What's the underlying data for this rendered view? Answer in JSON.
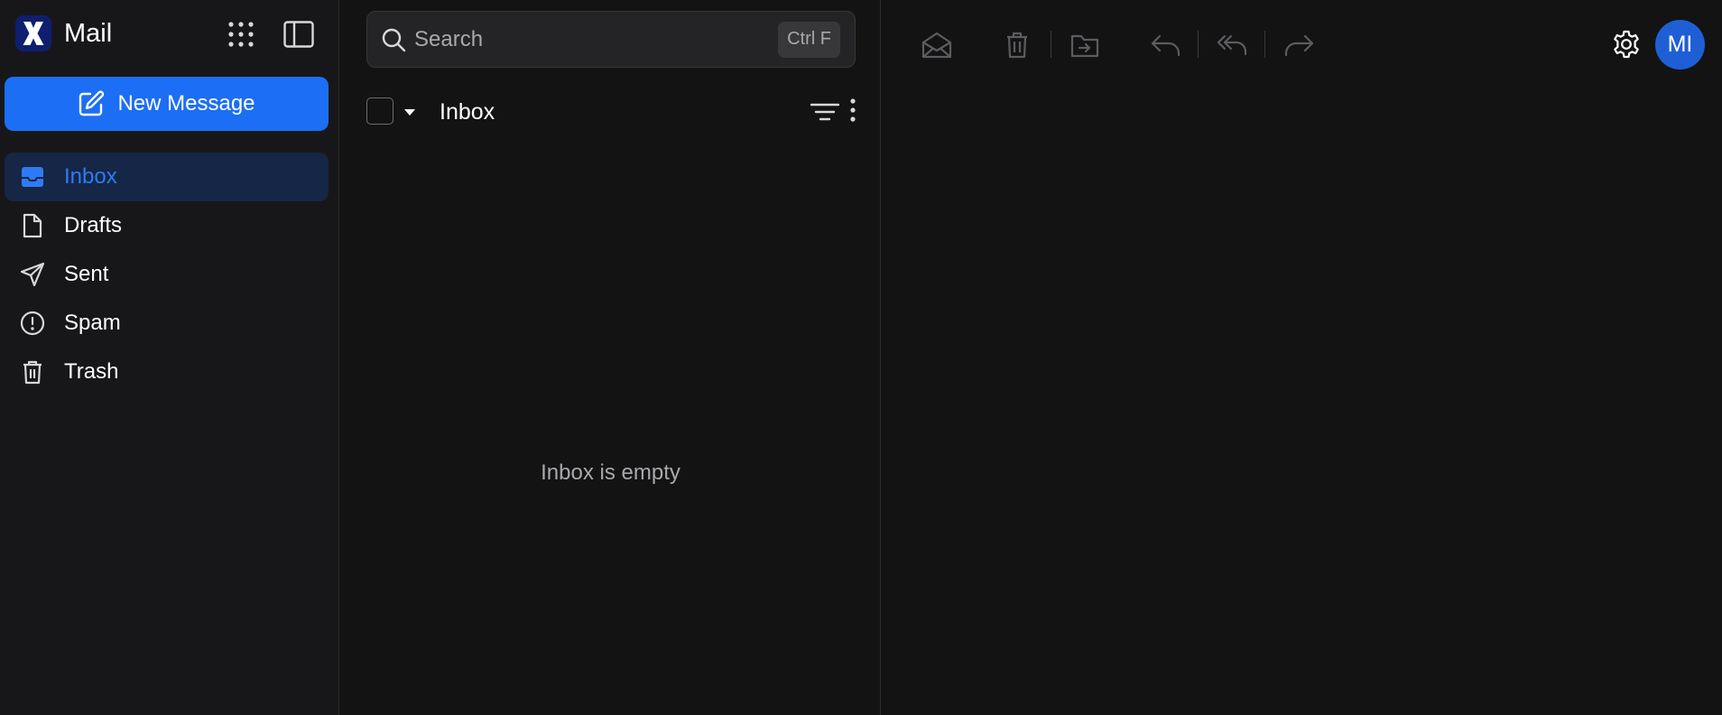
{
  "app": {
    "logo_letter": "X",
    "name": "Mail",
    "apps_icon": "apps-grid-icon",
    "sidebar_toggle_icon": "sidebar-toggle-icon"
  },
  "compose": {
    "label": "New Message",
    "icon": "compose-icon"
  },
  "sidebar": {
    "items": [
      {
        "label": "Inbox",
        "icon": "inbox-icon",
        "active": true
      },
      {
        "label": "Drafts",
        "icon": "file-icon"
      },
      {
        "label": "Sent",
        "icon": "send-icon"
      },
      {
        "label": "Spam",
        "icon": "alert-circle-icon"
      },
      {
        "label": "Trash",
        "icon": "trash-icon"
      }
    ]
  },
  "search": {
    "placeholder": "Search",
    "shortcut": "Ctrl F"
  },
  "list": {
    "title": "Inbox",
    "empty_message": "Inbox is empty"
  },
  "toolbar": {
    "icons": [
      "mark-read-icon",
      "delete-icon",
      "move-to-folder-icon",
      "reply-icon",
      "reply-all-icon",
      "forward-icon"
    ]
  },
  "user": {
    "initials": "MI"
  },
  "colors": {
    "accent": "#1c6ef5",
    "active_nav_bg": "#152646",
    "active_nav_text": "#2e7bf5",
    "sidebar_bg": "#17171a",
    "pane_bg": "#131313",
    "avatar_bg": "#1f5fd6",
    "logo_bg": "#0f1e6e"
  }
}
